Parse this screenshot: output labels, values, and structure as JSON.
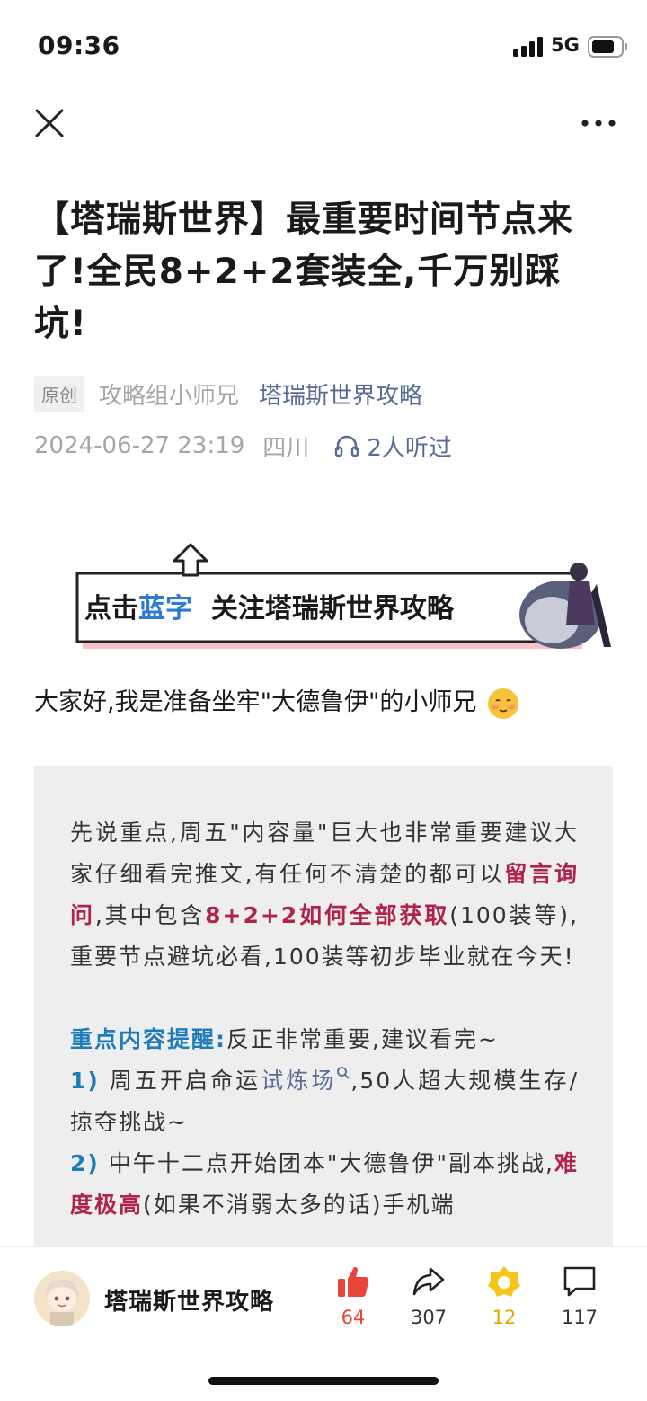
{
  "status_bar": {
    "time": "09:36",
    "network": "5G"
  },
  "article": {
    "title": "【塔瑞斯世界】最重要时间节点来了!全民8+2+2套装全,千万别踩坑!",
    "original_badge": "原创",
    "author": "攻略组小师兄",
    "account": "塔瑞斯世界攻略",
    "date": "2024-06-27 23:19",
    "location": "四川",
    "listened": "2人听过",
    "banner": {
      "prefix": "点击",
      "highlight": "蓝字",
      "suffix": "关注塔瑞斯世界攻略"
    },
    "greeting": "大家好,我是准备坐牢\"大德鲁伊\"的小师兄",
    "box": {
      "p1_a": "先说重点,周五\"内容量\"巨大也非常重要建议大家仔细看完推文,有任何不清楚的都可以",
      "p1_red1": "留言询问",
      "p1_b": ",其中包含",
      "p1_red2": "8+2+2如何全部获取",
      "p1_c": "(100装等),重要节点避坑必看,100装等初步毕业就在今天!",
      "p2_heading": "重点内容提醒:",
      "p2_text": "反正非常重要,建议看完~",
      "item1_num": "1)",
      "item1_a": "周五开启命运",
      "item1_link": "试炼场",
      "item1_b": ",50人超大规模生存/掠夺挑战~",
      "item2_num": "2)",
      "item2_a": "中午十二点开始团本\"大德鲁伊\"副本挑战,",
      "item2_red": "难度极高",
      "item2_b": "(如果不消弱太多的话)手机端"
    }
  },
  "bottom_bar": {
    "account_name": "塔瑞斯世界攻略",
    "like_count": "64",
    "share_count": "307",
    "star_count": "12",
    "comment_count": "117"
  },
  "colors": {
    "link": "#576b95",
    "red": "#b0234a",
    "blue": "#1e7cb8",
    "like": "#e8453c",
    "star": "#f5c518"
  }
}
